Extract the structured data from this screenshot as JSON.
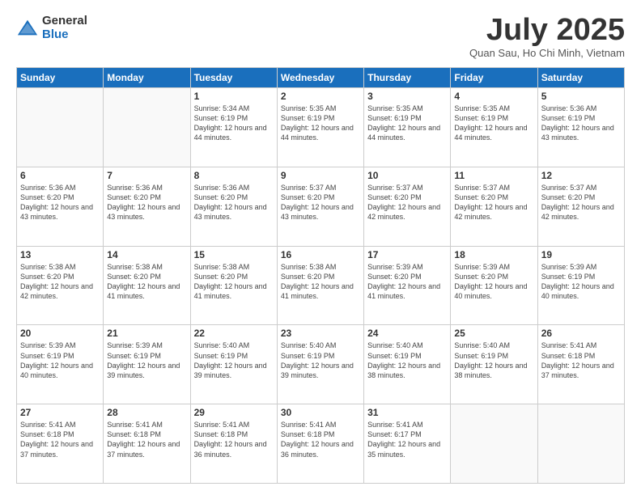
{
  "logo": {
    "general": "General",
    "blue": "Blue"
  },
  "title": "July 2025",
  "location": "Quan Sau, Ho Chi Minh, Vietnam",
  "weekdays": [
    "Sunday",
    "Monday",
    "Tuesday",
    "Wednesday",
    "Thursday",
    "Friday",
    "Saturday"
  ],
  "weeks": [
    [
      {
        "day": "",
        "info": ""
      },
      {
        "day": "",
        "info": ""
      },
      {
        "day": "1",
        "info": "Sunrise: 5:34 AM\nSunset: 6:19 PM\nDaylight: 12 hours and 44 minutes."
      },
      {
        "day": "2",
        "info": "Sunrise: 5:35 AM\nSunset: 6:19 PM\nDaylight: 12 hours and 44 minutes."
      },
      {
        "day": "3",
        "info": "Sunrise: 5:35 AM\nSunset: 6:19 PM\nDaylight: 12 hours and 44 minutes."
      },
      {
        "day": "4",
        "info": "Sunrise: 5:35 AM\nSunset: 6:19 PM\nDaylight: 12 hours and 44 minutes."
      },
      {
        "day": "5",
        "info": "Sunrise: 5:36 AM\nSunset: 6:19 PM\nDaylight: 12 hours and 43 minutes."
      }
    ],
    [
      {
        "day": "6",
        "info": "Sunrise: 5:36 AM\nSunset: 6:20 PM\nDaylight: 12 hours and 43 minutes."
      },
      {
        "day": "7",
        "info": "Sunrise: 5:36 AM\nSunset: 6:20 PM\nDaylight: 12 hours and 43 minutes."
      },
      {
        "day": "8",
        "info": "Sunrise: 5:36 AM\nSunset: 6:20 PM\nDaylight: 12 hours and 43 minutes."
      },
      {
        "day": "9",
        "info": "Sunrise: 5:37 AM\nSunset: 6:20 PM\nDaylight: 12 hours and 43 minutes."
      },
      {
        "day": "10",
        "info": "Sunrise: 5:37 AM\nSunset: 6:20 PM\nDaylight: 12 hours and 42 minutes."
      },
      {
        "day": "11",
        "info": "Sunrise: 5:37 AM\nSunset: 6:20 PM\nDaylight: 12 hours and 42 minutes."
      },
      {
        "day": "12",
        "info": "Sunrise: 5:37 AM\nSunset: 6:20 PM\nDaylight: 12 hours and 42 minutes."
      }
    ],
    [
      {
        "day": "13",
        "info": "Sunrise: 5:38 AM\nSunset: 6:20 PM\nDaylight: 12 hours and 42 minutes."
      },
      {
        "day": "14",
        "info": "Sunrise: 5:38 AM\nSunset: 6:20 PM\nDaylight: 12 hours and 41 minutes."
      },
      {
        "day": "15",
        "info": "Sunrise: 5:38 AM\nSunset: 6:20 PM\nDaylight: 12 hours and 41 minutes."
      },
      {
        "day": "16",
        "info": "Sunrise: 5:38 AM\nSunset: 6:20 PM\nDaylight: 12 hours and 41 minutes."
      },
      {
        "day": "17",
        "info": "Sunrise: 5:39 AM\nSunset: 6:20 PM\nDaylight: 12 hours and 41 minutes."
      },
      {
        "day": "18",
        "info": "Sunrise: 5:39 AM\nSunset: 6:20 PM\nDaylight: 12 hours and 40 minutes."
      },
      {
        "day": "19",
        "info": "Sunrise: 5:39 AM\nSunset: 6:19 PM\nDaylight: 12 hours and 40 minutes."
      }
    ],
    [
      {
        "day": "20",
        "info": "Sunrise: 5:39 AM\nSunset: 6:19 PM\nDaylight: 12 hours and 40 minutes."
      },
      {
        "day": "21",
        "info": "Sunrise: 5:39 AM\nSunset: 6:19 PM\nDaylight: 12 hours and 39 minutes."
      },
      {
        "day": "22",
        "info": "Sunrise: 5:40 AM\nSunset: 6:19 PM\nDaylight: 12 hours and 39 minutes."
      },
      {
        "day": "23",
        "info": "Sunrise: 5:40 AM\nSunset: 6:19 PM\nDaylight: 12 hours and 39 minutes."
      },
      {
        "day": "24",
        "info": "Sunrise: 5:40 AM\nSunset: 6:19 PM\nDaylight: 12 hours and 38 minutes."
      },
      {
        "day": "25",
        "info": "Sunrise: 5:40 AM\nSunset: 6:19 PM\nDaylight: 12 hours and 38 minutes."
      },
      {
        "day": "26",
        "info": "Sunrise: 5:41 AM\nSunset: 6:18 PM\nDaylight: 12 hours and 37 minutes."
      }
    ],
    [
      {
        "day": "27",
        "info": "Sunrise: 5:41 AM\nSunset: 6:18 PM\nDaylight: 12 hours and 37 minutes."
      },
      {
        "day": "28",
        "info": "Sunrise: 5:41 AM\nSunset: 6:18 PM\nDaylight: 12 hours and 37 minutes."
      },
      {
        "day": "29",
        "info": "Sunrise: 5:41 AM\nSunset: 6:18 PM\nDaylight: 12 hours and 36 minutes."
      },
      {
        "day": "30",
        "info": "Sunrise: 5:41 AM\nSunset: 6:18 PM\nDaylight: 12 hours and 36 minutes."
      },
      {
        "day": "31",
        "info": "Sunrise: 5:41 AM\nSunset: 6:17 PM\nDaylight: 12 hours and 35 minutes."
      },
      {
        "day": "",
        "info": ""
      },
      {
        "day": "",
        "info": ""
      }
    ]
  ]
}
